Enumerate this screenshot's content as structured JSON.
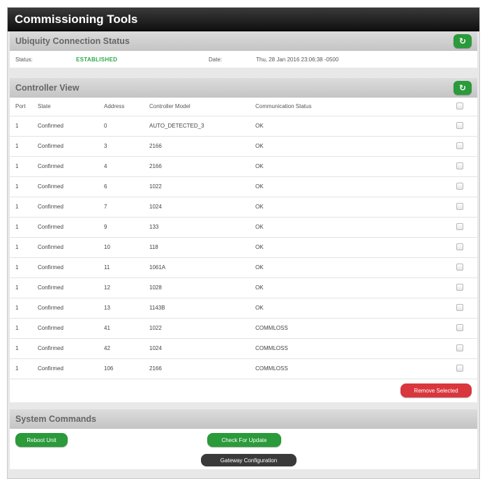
{
  "app": {
    "title": "Commissioning Tools"
  },
  "connection": {
    "section_title": "Ubiquity Connection Status",
    "status_label": "Status:",
    "status_value": "ESTABLISHED",
    "date_label": "Date:",
    "date_value": "Thu, 28 Jan 2016 23:06:38 -0500",
    "refresh_icon": "refresh-icon"
  },
  "controller": {
    "section_title": "Controller View",
    "refresh_icon": "refresh-icon",
    "columns": [
      "Port",
      "State",
      "Address",
      "Controller Model",
      "Communication Status"
    ],
    "rows": [
      {
        "port": "1",
        "state": "Confirmed",
        "address": "0",
        "model": "AUTO_DETECTED_3",
        "comm": "OK"
      },
      {
        "port": "1",
        "state": "Confirmed",
        "address": "3",
        "model": "2166",
        "comm": "OK"
      },
      {
        "port": "1",
        "state": "Confirmed",
        "address": "4",
        "model": "2166",
        "comm": "OK"
      },
      {
        "port": "1",
        "state": "Confirmed",
        "address": "6",
        "model": "1022",
        "comm": "OK"
      },
      {
        "port": "1",
        "state": "Confirmed",
        "address": "7",
        "model": "1024",
        "comm": "OK"
      },
      {
        "port": "1",
        "state": "Confirmed",
        "address": "9",
        "model": "133",
        "comm": "OK"
      },
      {
        "port": "1",
        "state": "Confirmed",
        "address": "10",
        "model": "118",
        "comm": "OK"
      },
      {
        "port": "1",
        "state": "Confirmed",
        "address": "11",
        "model": "1061A",
        "comm": "OK"
      },
      {
        "port": "1",
        "state": "Confirmed",
        "address": "12",
        "model": "1028",
        "comm": "OK"
      },
      {
        "port": "1",
        "state": "Confirmed",
        "address": "13",
        "model": "1143B",
        "comm": "OK"
      },
      {
        "port": "1",
        "state": "Confirmed",
        "address": "41",
        "model": "1022",
        "comm": "COMMLOSS"
      },
      {
        "port": "1",
        "state": "Confirmed",
        "address": "42",
        "model": "1024",
        "comm": "COMMLOSS"
      },
      {
        "port": "1",
        "state": "Confirmed",
        "address": "106",
        "model": "2166",
        "comm": "COMMLOSS"
      }
    ],
    "remove_label": "Remove Selected"
  },
  "system": {
    "section_title": "System Commands",
    "reboot_label": "Reboot Unit",
    "update_label": "Check For Update",
    "gateway_label": "Gateway Configuration"
  },
  "colors": {
    "green": "#2a9a3a",
    "red": "#d9363e",
    "established": "#2fa84a",
    "titlebar": "#1a1a1a"
  }
}
